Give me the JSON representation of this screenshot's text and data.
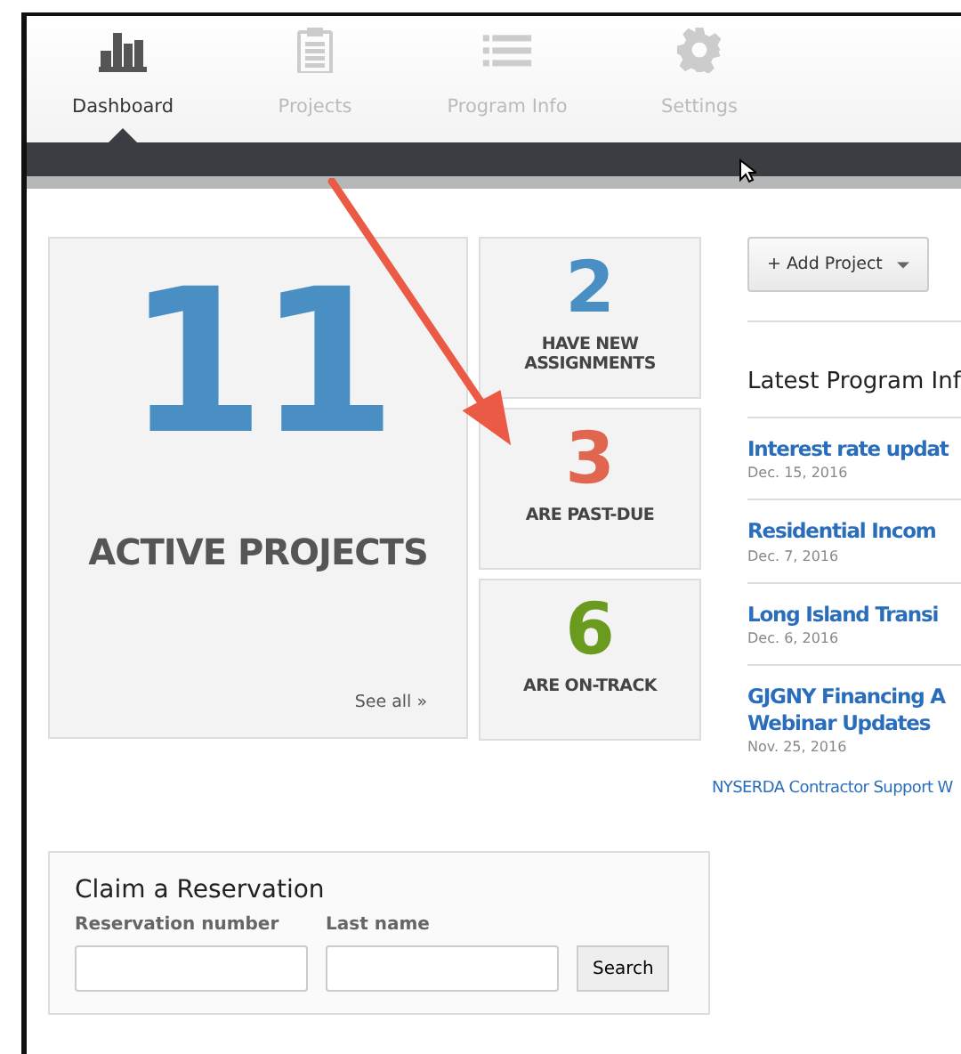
{
  "nav": [
    {
      "label": "Dashboard",
      "selected": true
    },
    {
      "label": "Projects",
      "selected": false
    },
    {
      "label": "Program Info",
      "selected": false
    },
    {
      "label": "Settings",
      "selected": false
    }
  ],
  "active": {
    "count": "11",
    "label": "ACTIVE PROJECTS",
    "link": "See all »"
  },
  "stats": [
    {
      "count": "2",
      "label": "HAVE NEW ASSIGNMENTS",
      "color": "#4a8fc4"
    },
    {
      "count": "3",
      "label": "ARE PAST-DUE",
      "color": "#e06650"
    },
    {
      "count": "6",
      "label": "ARE ON-TRACK",
      "color": "#6a9a1e"
    }
  ],
  "add_button": {
    "label": "+ Add Project"
  },
  "news": {
    "title": "Latest Program Inf",
    "items": [
      {
        "title": "Interest rate updat",
        "date": "Dec. 15, 2016"
      },
      {
        "title": "Residential Incom",
        "date": "Dec. 7, 2016"
      },
      {
        "title": "Long Island Transi",
        "date": "Dec. 6, 2016"
      },
      {
        "title": "GJGNY Financing A",
        "title2": "Webinar Updates",
        "date": "Nov. 25, 2016"
      }
    ],
    "footer_link": "NYSERDA Contractor Support W"
  },
  "claim": {
    "title": "Claim a Reservation",
    "fields": [
      {
        "label": "Reservation number"
      },
      {
        "label": "Last name"
      }
    ],
    "button": "Search"
  }
}
